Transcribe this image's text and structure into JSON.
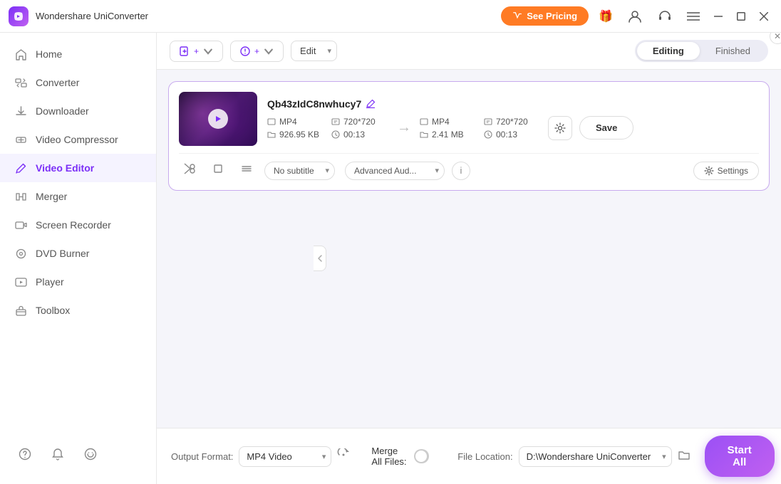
{
  "app": {
    "title": "Wondershare UniConverter",
    "logo_gradient": "linear-gradient(135deg, #7b2ff7, #c060f0)"
  },
  "titlebar": {
    "see_pricing_label": "See Pricing",
    "window_controls": [
      "minimize",
      "maximize",
      "close"
    ]
  },
  "sidebar": {
    "items": [
      {
        "id": "home",
        "label": "Home",
        "icon": "home-icon"
      },
      {
        "id": "converter",
        "label": "Converter",
        "icon": "converter-icon"
      },
      {
        "id": "downloader",
        "label": "Downloader",
        "icon": "downloader-icon"
      },
      {
        "id": "video-compressor",
        "label": "Video Compressor",
        "icon": "compress-icon"
      },
      {
        "id": "video-editor",
        "label": "Video Editor",
        "icon": "editor-icon",
        "active": true
      },
      {
        "id": "merger",
        "label": "Merger",
        "icon": "merger-icon"
      },
      {
        "id": "screen-recorder",
        "label": "Screen Recorder",
        "icon": "recorder-icon"
      },
      {
        "id": "dvd-burner",
        "label": "DVD Burner",
        "icon": "dvd-icon"
      },
      {
        "id": "player",
        "label": "Player",
        "icon": "player-icon"
      },
      {
        "id": "toolbox",
        "label": "Toolbox",
        "icon": "toolbox-icon"
      }
    ],
    "bottom_icons": [
      "help-icon",
      "bell-icon",
      "feedback-icon"
    ]
  },
  "toolbar": {
    "add_file_label": "Add File",
    "add_media_label": "Add Media",
    "edit_label": "Edit",
    "tabs": {
      "editing": "Editing",
      "finished": "Finished"
    }
  },
  "video_card": {
    "filename": "Qb43zIdC8nwhucy7",
    "input": {
      "format": "MP4",
      "resolution": "720*720",
      "size": "926.95 KB",
      "duration": "00:13"
    },
    "output": {
      "format": "MP4",
      "resolution": "720*720",
      "size": "2.41 MB",
      "duration": "00:13"
    },
    "save_label": "Save",
    "subtitle_label": "No subtitle",
    "audio_label": "Advanced Aud...",
    "settings_label": "Settings"
  },
  "bottom_bar": {
    "output_format_label": "Output Format:",
    "output_format_value": "MP4 Video",
    "file_location_label": "File Location:",
    "file_location_value": "D:\\Wondershare UniConverter",
    "merge_label": "Merge All Files:",
    "start_all_label": "Start All"
  }
}
